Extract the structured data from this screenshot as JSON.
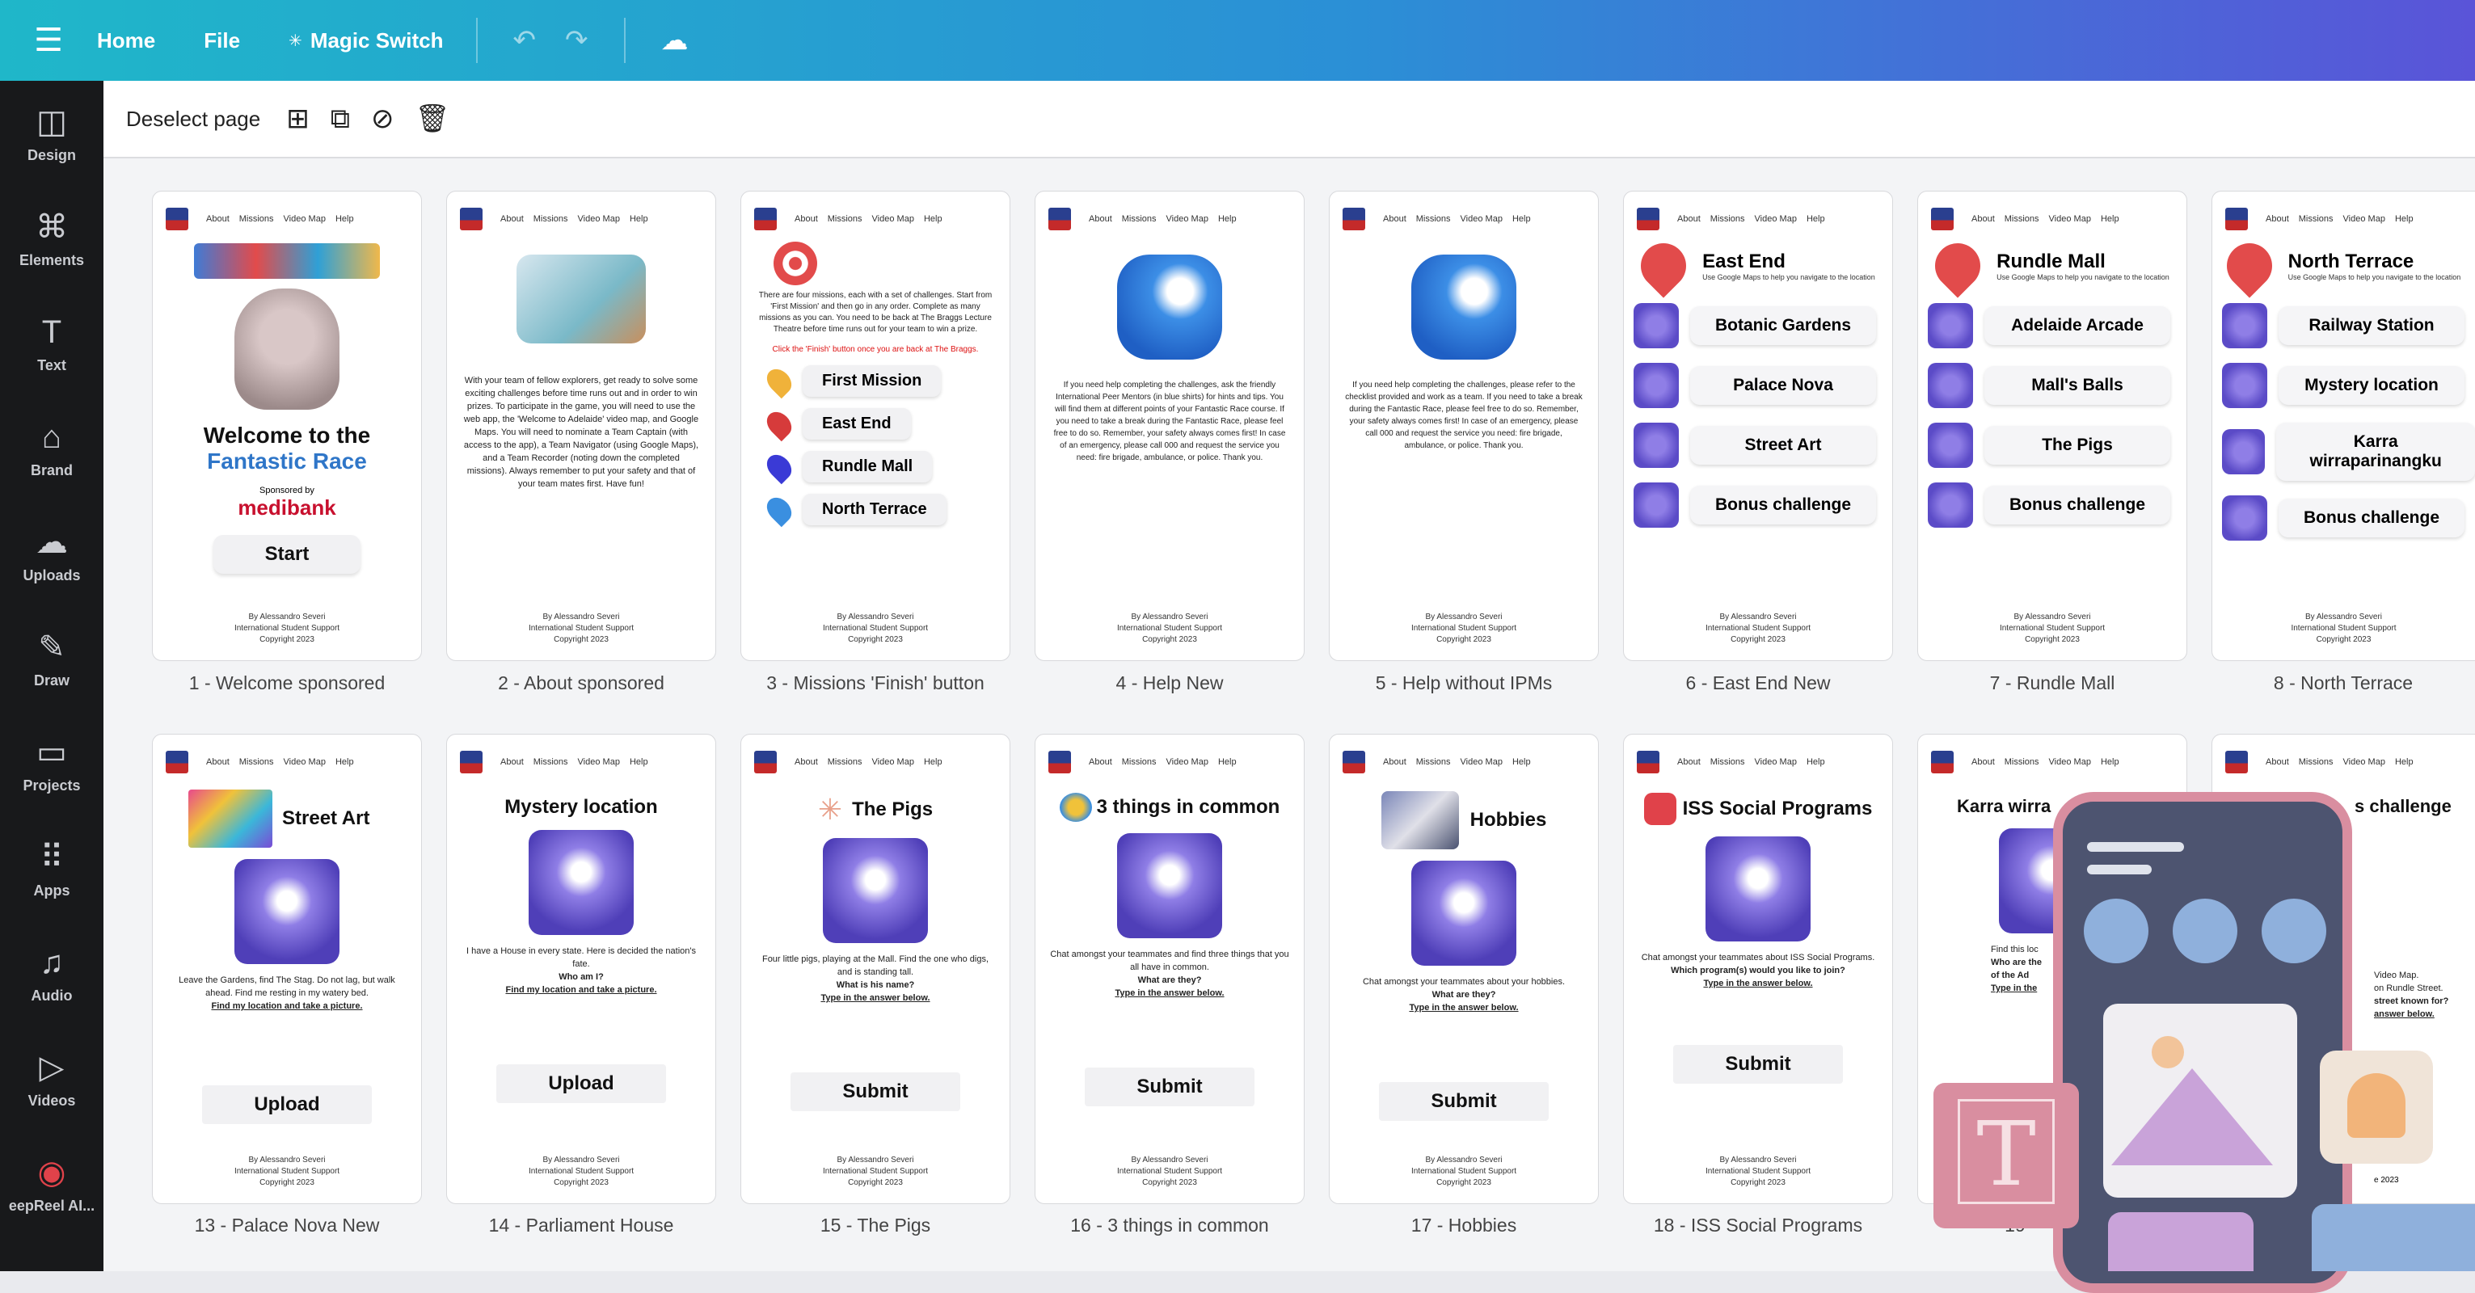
{
  "topbar": {
    "home": "Home",
    "file": "File",
    "magic_switch": "Magic Switch",
    "magic_icon": "sparkle-icon",
    "undo_icon": "undo-icon",
    "redo_icon": "redo-icon",
    "save_icon": "cloud-check-icon"
  },
  "sidebar": [
    {
      "label": "Design",
      "icon": "◫"
    },
    {
      "label": "Elements",
      "icon": "⌘"
    },
    {
      "label": "Text",
      "icon": "T"
    },
    {
      "label": "Brand",
      "icon": "⌂"
    },
    {
      "label": "Uploads",
      "icon": "☁"
    },
    {
      "label": "Draw",
      "icon": "✎"
    },
    {
      "label": "Projects",
      "icon": "▭"
    },
    {
      "label": "Apps",
      "icon": "⠿"
    },
    {
      "label": "Audio",
      "icon": "♫"
    },
    {
      "label": "Videos",
      "icon": "▷"
    },
    {
      "label": "eepReel AI...",
      "icon": "◉"
    }
  ],
  "toolbar": {
    "deselect": "Deselect page"
  },
  "nav": {
    "about": "About",
    "missions": "Missions",
    "videomap": "Video Map",
    "help": "Help"
  },
  "footer": {
    "l1": "By Alessandro Severi",
    "l2": "International Student Support",
    "l3": "Copyright 2023"
  },
  "pages": [
    {
      "label": "1 - Welcome sponsored"
    },
    {
      "label": "2 - About sponsored"
    },
    {
      "label": "3 - Missions 'Finish' button"
    },
    {
      "label": "4 - Help New"
    },
    {
      "label": "5 - Help without IPMs"
    },
    {
      "label": "6 - East End New"
    },
    {
      "label": "7 - Rundle Mall"
    },
    {
      "label": "8 - North Terrace"
    },
    {
      "label": "13 - Palace Nova New"
    },
    {
      "label": "14 - Parliament House"
    },
    {
      "label": "15 - The Pigs"
    },
    {
      "label": "16 - 3 things in common"
    },
    {
      "label": "17 - Hobbies"
    },
    {
      "label": "18 - ISS Social Programs"
    }
  ],
  "p1": {
    "t1": "Welcome to the",
    "t2": "Fantastic Race",
    "sponsored": "Sponsored by",
    "sponsor": "medibank",
    "btn": "Start"
  },
  "p2": {
    "text": "With your team of fellow explorers, get ready to solve some exciting challenges before time runs out and in order to win prizes. To participate in the game, you will need to use the web app, the 'Welcome to Adelaide' video map, and Google Maps. You will need to nominate a Team Captain (with access to the app), a Team Navigator (using Google Maps), and a Team Recorder (noting down the completed missions). Always remember to put your safety and that of your team mates first. Have fun!"
  },
  "p3": {
    "intro": "There are four missions, each with a set of challenges. Start from 'First Mission' and then go in any order. Complete as many missions as you can. You need to be back at The Braggs Lecture Theatre before time runs out for your team to win a prize.",
    "red": "Click the 'Finish' button once you are back at The Braggs.",
    "missions": [
      "First Mission",
      "East End",
      "Rundle Mall",
      "North Terrace"
    ]
  },
  "p4": {
    "text": "If you need help completing the challenges, ask the friendly International Peer Mentors (in blue shirts) for hints and tips. You will find them at different points of your Fantastic Race course. If you need to take a break during the Fantastic Race, please feel free to do so. Remember, your safety always comes first! In case of an emergency, please call 000 and request the service you need: fire brigade, ambulance, or police. Thank you."
  },
  "p5": {
    "text": "If you need help completing the challenges, please refer to the checklist provided and work as a team. If you need to take a break during the Fantastic Race, please feel free to do so. Remember, your safety always comes first! In case of an emergency, please call 000 and request the service you need: fire brigade, ambulance, or police. Thank you."
  },
  "locsub": "Use Google Maps to help you navigate to the location",
  "p6": {
    "title": "East End",
    "items": [
      "Botanic Gardens",
      "Palace Nova",
      "Street Art",
      "Bonus challenge"
    ]
  },
  "p7": {
    "title": "Rundle Mall",
    "items": [
      "Adelaide Arcade",
      "Mall's Balls",
      "The Pigs",
      "Bonus challenge"
    ]
  },
  "p8": {
    "title": "North Terrace",
    "items": [
      "Railway Station",
      "Mystery location",
      "Karra wirraparinangku",
      "Bonus challenge"
    ]
  },
  "p13": {
    "title": "Street Art",
    "text": "Leave the Gardens, find The Stag. Do not lag, but walk ahead. Find me resting in my watery bed.",
    "task": "Find my location and take a picture.",
    "btn": "Upload"
  },
  "p14": {
    "title": "Mystery location",
    "text": "I have a House in every state. Here is decided the nation's fate.",
    "q": "Who am I?",
    "task": "Find my location and take a picture.",
    "btn": "Upload"
  },
  "p15": {
    "title": "The Pigs",
    "text": "Four little pigs, playing at the Mall. Find the one who digs, and is standing tall.",
    "q": "What is his name?",
    "task": "Type in the answer below.",
    "btn": "Submit"
  },
  "p16": {
    "title": "3 things in common",
    "text": "Chat amongst your teammates and find three things that you all have in common.",
    "q": "What are they?",
    "task": "Type in the answer below.",
    "btn": "Submit"
  },
  "p17": {
    "title": "Hobbies",
    "text": "Chat amongst your teammates about your hobbies.",
    "q": "What are they?",
    "task": "Type in the answer below.",
    "btn": "Submit"
  },
  "p18": {
    "title": "ISS Social Programs",
    "text": "Chat amongst your teammates about ISS Social Programs.",
    "q": "Which program(s) would you like to join?",
    "task": "Type in the answer below.",
    "btn": "Submit"
  },
  "p19": {
    "title": "Karra wirra",
    "text": "Find this loc",
    "q": "Who are the",
    "q2": "of the Ad",
    "task": "Type in the",
    "label": "19 -"
  },
  "p20": {
    "title": "s challenge",
    "text": "Video Map.",
    "q": "on Rundle Street.",
    "q2": "street known for?",
    "task": "answer below.",
    "year": "e 2023"
  },
  "promo": {
    "t_letter": "T"
  }
}
